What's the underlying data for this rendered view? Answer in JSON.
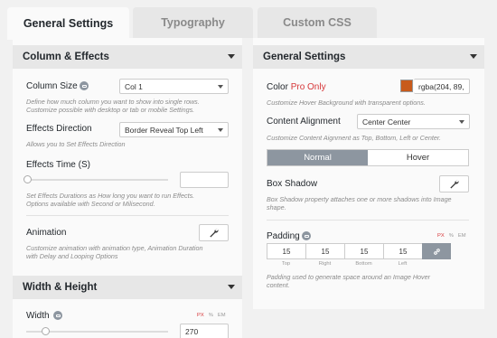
{
  "tabs": [
    {
      "label": "General Settings"
    },
    {
      "label": "Typography"
    },
    {
      "label": "Custom CSS"
    }
  ],
  "left": {
    "column_effects": {
      "title": "Column & Effects",
      "column_size": {
        "label": "Column Size",
        "value": "Col 1",
        "desc_1": "Define how much column you want to show into single rows.",
        "desc_2": "Customize possible with desktop or tab or mobile Settings."
      },
      "effects_direction": {
        "label": "Effects Direction",
        "value": "Border Reveal Top Left",
        "desc": "Allows you to Set Effects Direction"
      },
      "effects_time": {
        "label": "Effects Time (S)",
        "value": "",
        "desc_1": "Set Effects Durations as How long you want to run Effects.",
        "desc_2": "Options available with Second or Milisecond."
      },
      "animation": {
        "label": "Animation",
        "desc_1": "Customize animation with animation type, Animation Duration",
        "desc_2": "with Delay and Looping Options"
      }
    },
    "width_height": {
      "title": "Width & Height",
      "width": {
        "label": "Width",
        "value": "270",
        "units": [
          "PX",
          "%",
          "EM"
        ]
      }
    }
  },
  "right": {
    "general_settings": {
      "title": "General Settings",
      "color": {
        "label": "Color",
        "pro": "Pro Only",
        "value": "rgba(204, 89,",
        "swatch": "#c85b1c",
        "desc": "Customize Hover Background with transparent options."
      },
      "content_alignment": {
        "label": "Content Alignment",
        "value": "Center Center",
        "desc": "Customize Content Aignment as Top, Bottom, Left or Center."
      },
      "state_toggle": {
        "normal": "Normal",
        "hover": "Hover"
      },
      "box_shadow": {
        "label": "Box Shadow",
        "desc_1": "Box Shadow property attaches one or more shadows into Image",
        "desc_2": "shape."
      },
      "padding": {
        "label": "Padding",
        "units": [
          "PX",
          "%",
          "EM"
        ],
        "values": [
          "15",
          "15",
          "15",
          "15"
        ],
        "sides": [
          "Top",
          "Right",
          "Bottom",
          "Left"
        ],
        "desc_1": "Padding used to generate space around an Image Hover",
        "desc_2": "content."
      }
    }
  },
  "colors": {
    "accent": "#d63638",
    "toggle_active": "#8d96a0"
  }
}
